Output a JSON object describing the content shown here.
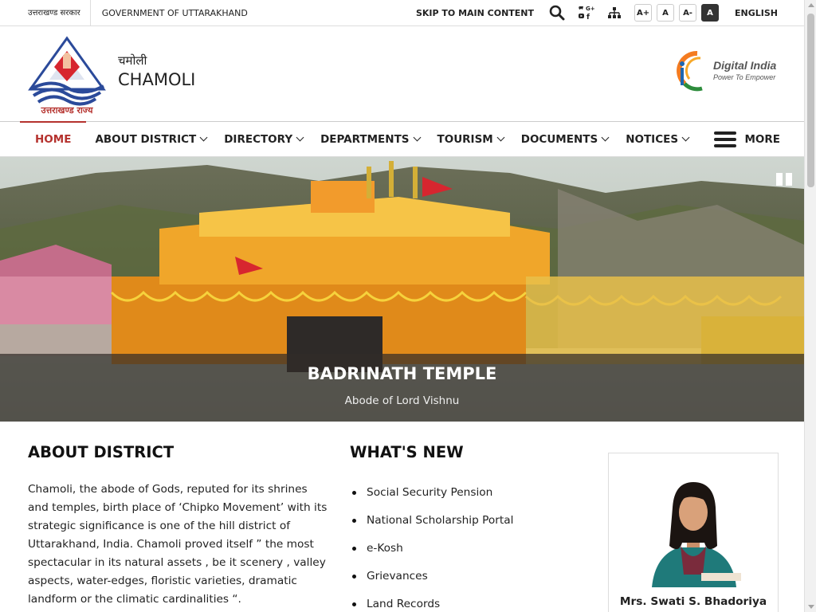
{
  "topbar": {
    "gov_hindi": "उत्तराखण्ड सरकार",
    "gov_english": "GOVERNMENT OF UTTARAKHAND",
    "skip_link": "SKIP TO MAIN CONTENT",
    "font_sizes": [
      "A+",
      "A",
      "A-",
      "A"
    ],
    "language": "ENGLISH"
  },
  "header": {
    "logo_caption": "उत्तराखण्ड राज्य",
    "site_name_hindi": "चमोली",
    "site_name_english": "CHAMOLI",
    "digital_india_title": "Digital India",
    "digital_india_tagline": "Power To Empower"
  },
  "nav": {
    "items": [
      {
        "label": "HOME",
        "dropdown": false
      },
      {
        "label": "ABOUT DISTRICT",
        "dropdown": true
      },
      {
        "label": "DIRECTORY",
        "dropdown": true
      },
      {
        "label": "DEPARTMENTS",
        "dropdown": true
      },
      {
        "label": "TOURISM",
        "dropdown": true
      },
      {
        "label": "DOCUMENTS",
        "dropdown": true
      },
      {
        "label": "NOTICES",
        "dropdown": true
      }
    ],
    "more": "MORE"
  },
  "hero": {
    "title": "BADRINATH TEMPLE",
    "subtitle": "Abode of Lord Vishnu"
  },
  "about": {
    "heading": "ABOUT DISTRICT",
    "text": "Chamoli, the abode of Gods, reputed for its shrines and temples, birth place of ‘Chipko Movement’ with its strategic significance is one of the hill district of Uttarakhand, India. Chamoli proved itself  ” the most spectacular in its natural assets , be it scenery , valley aspects, water-edges, floristic varieties, dramatic landform or the climatic cardinalities “."
  },
  "whats_new": {
    "heading": "WHAT'S NEW",
    "items": [
      "Social Security Pension",
      "National Scholarship Portal",
      "e-Kosh",
      "Grievances",
      "Land Records"
    ]
  },
  "dm": {
    "name": "Mrs. Swati S. Bhadoriya"
  },
  "colors": {
    "accent": "#b5322e",
    "caption_bg": "#322d28"
  }
}
